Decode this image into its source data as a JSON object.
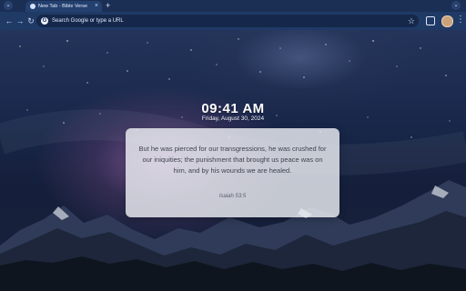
{
  "browser": {
    "tab_title": "New Tab - Bible Verse",
    "new_tab_symbol": "+",
    "address_placeholder": "Search Google or type a URL",
    "search_engine_letter": "G",
    "icons": {
      "tab_search": "tab-search-icon",
      "favicon": "bible-verse-favicon",
      "close": "close-icon",
      "back": "back-arrow-icon",
      "forward": "forward-arrow-icon",
      "reload": "reload-icon",
      "bookmark": "star-icon",
      "extensions": "puzzle-icon",
      "profile": "avatar",
      "menu": "three-dot-menu-icon"
    }
  },
  "page": {
    "time": "09:41 AM",
    "date": "Friday, August 30, 2024",
    "verse": {
      "text": "But he was pierced for our transgressions, he was crushed for our iniquities; the punishment that brought us peace was on him, and by his wounds we are healed.",
      "reference": "Isaiah 53:5"
    }
  }
}
